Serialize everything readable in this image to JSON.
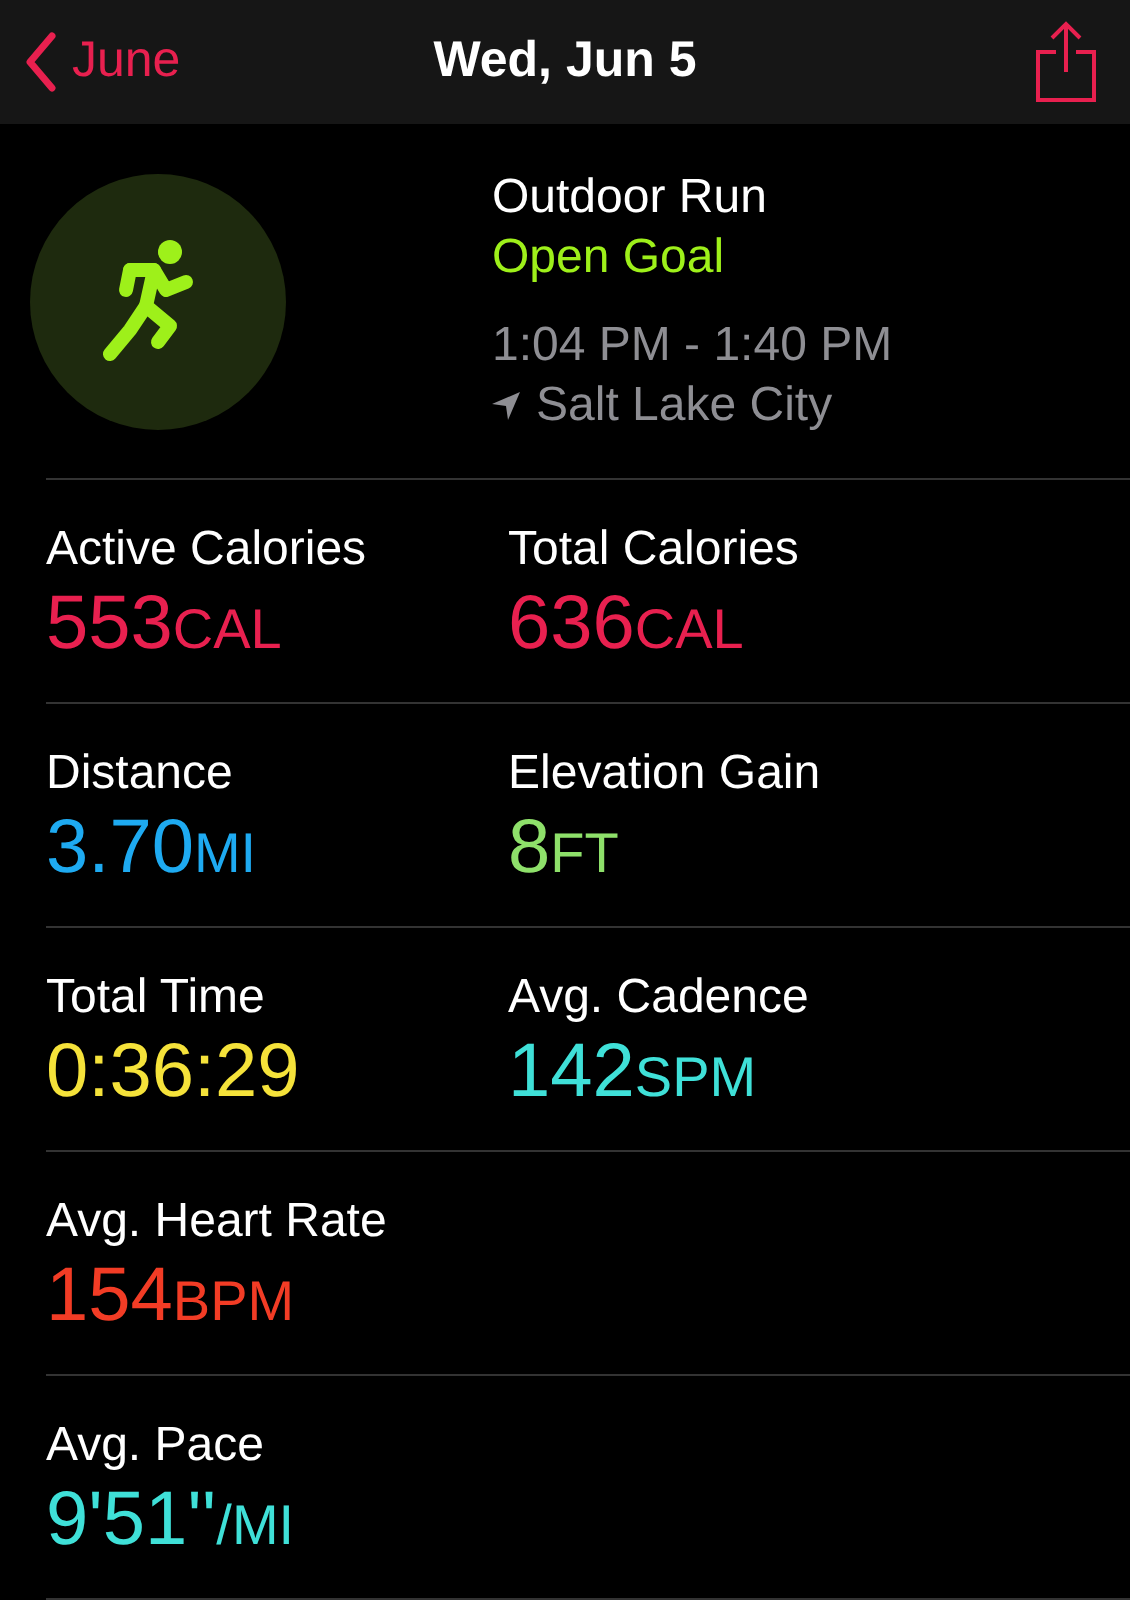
{
  "nav_bar": {
    "back_label": "June",
    "title": "Wed, Jun 5"
  },
  "workout": {
    "name": "Outdoor Run",
    "goal": "Open Goal",
    "time_range": "1:04 PM - 1:40 PM",
    "location": "Salt Lake City"
  },
  "metric_rows": [
    {
      "metrics": [
        {
          "label": "Active Calories",
          "value": "553",
          "unit": "CAL",
          "color": "#e8204f"
        },
        {
          "label": "Total Calories",
          "value": "636",
          "unit": "CAL",
          "color": "#e8204f"
        }
      ]
    },
    {
      "metrics": [
        {
          "label": "Distance",
          "value": "3.70",
          "unit": "MI",
          "color": "#1eaaf1"
        },
        {
          "label": "Elevation Gain",
          "value": "8",
          "unit": "FT",
          "color": "#8ee06a"
        }
      ]
    },
    {
      "metrics": [
        {
          "label": "Total Time",
          "value": "0:36:29",
          "color": "#f5e23a"
        },
        {
          "label": "Avg. Cadence",
          "value": "142",
          "unit": "SPM",
          "color": "#3fe0d8"
        }
      ]
    },
    {
      "metrics": [
        {
          "label": "Avg. Heart Rate",
          "value": "154",
          "unit": "BPM",
          "color": "#f23c25"
        }
      ]
    },
    {
      "metrics": [
        {
          "label": "Avg. Pace",
          "value": "9'51''",
          "unit": "/MI",
          "color": "#3fe0d8"
        }
      ]
    }
  ]
}
